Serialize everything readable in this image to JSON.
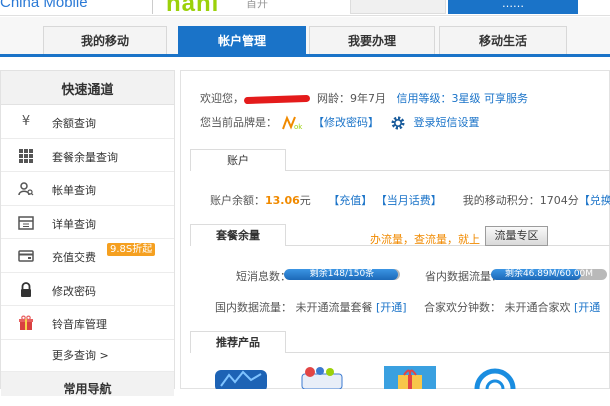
{
  "header": {
    "operator_logo": "China Mobile",
    "brand_logo": "hahi",
    "brand_sub": "首开",
    "top_tab_right": "……"
  },
  "nav": {
    "tabs": [
      "我的移动",
      "帐户管理",
      "我要办理",
      "移动生活"
    ]
  },
  "sidebar": {
    "title": "快速通道",
    "items": [
      {
        "label": "余额查询",
        "icon": "yen-icon"
      },
      {
        "label": "套餐余量查询",
        "icon": "grid-icon"
      },
      {
        "label": "帐单查询",
        "icon": "person-search-icon"
      },
      {
        "label": "详单查询",
        "icon": "calendar-icon"
      },
      {
        "label": "充值交费",
        "icon": "card-icon"
      },
      {
        "label": "修改密码",
        "icon": "lock-icon"
      },
      {
        "label": "铃音库管理",
        "icon": "gift-icon"
      }
    ],
    "recharge_badge": "9.8S折起",
    "more": "更多查询 >",
    "next_section": "常用导航"
  },
  "account": {
    "welcome": "欢迎您，",
    "age_label": "网龄：9年7月",
    "level_label": "信用等级：3星级",
    "service_link": "可享服务",
    "brand_label": "您当前品牌是：",
    "change_password": "【修改密码】",
    "sms_settings": "登录短信设置",
    "tab_account": "账户",
    "balance_label": "账户余额：",
    "balance_value": "13.06",
    "balance_unit": "元",
    "recharge_link": "【充值】",
    "month_fee_link": "【当月话费】",
    "points_label": "我的移动积分：1704分",
    "exchange_link": "【兑换】"
  },
  "package": {
    "tab": "套餐余量",
    "promo_text": "办流量，查流量，就上",
    "flow_button": "流量专区",
    "sms_label": "短消息数：",
    "sms_bar_text": "剩余148/150条",
    "sms_remaining_fraction": 0.987,
    "data_label": "省内数据流量：",
    "data_bar_text": "剩余46.89M/60.00M",
    "data_remaining_fraction": 0.78,
    "national_label": "国内数据流量：",
    "national_status": "未开通流量套餐",
    "national_link": "[开通]",
    "family_label": "合家欢分钟数：",
    "family_status": "未开通合家欢",
    "family_link": "[开通"
  },
  "products": {
    "tab": "推荐产品",
    "items": [
      "chart-app-icon",
      "tv-app-icon",
      "gift-box-icon",
      "blue-circle-icon"
    ]
  },
  "colors": {
    "brand_blue": "#1a73c8",
    "orange": "#f08a00",
    "red": "#e41b1b",
    "green": "#9bd10a"
  }
}
